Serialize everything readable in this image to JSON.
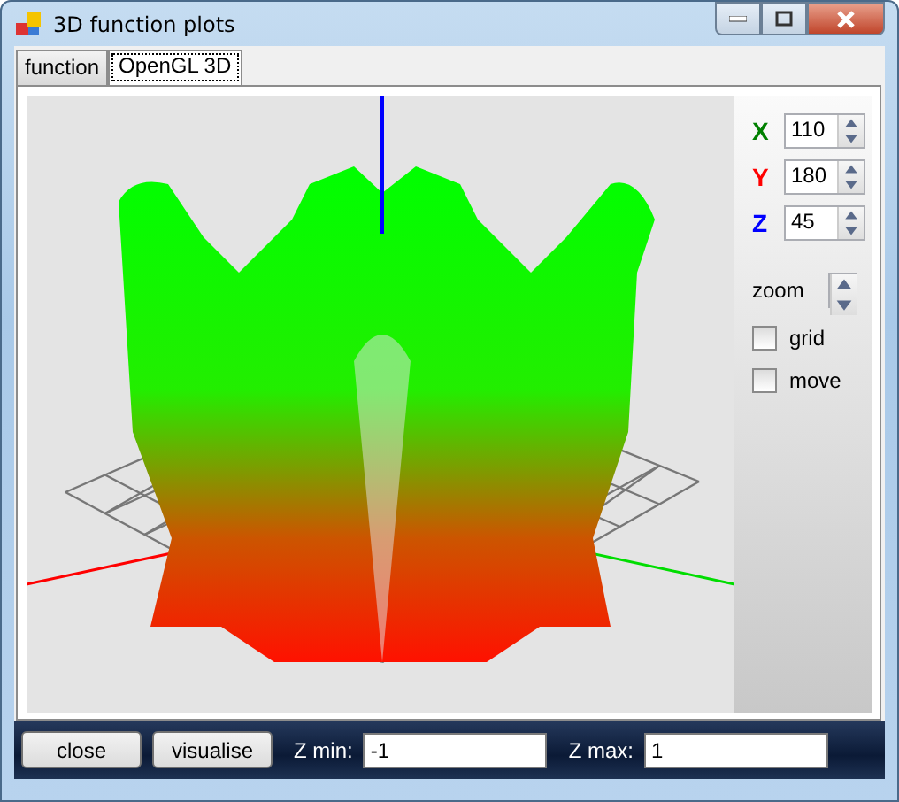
{
  "window": {
    "title": "3D function plots"
  },
  "tabs": [
    {
      "label": "function",
      "selected": false
    },
    {
      "label": "OpenGL 3D",
      "selected": true
    }
  ],
  "rotation": [
    {
      "axis": "X",
      "value": "110",
      "color": "#008000"
    },
    {
      "axis": "Y",
      "value": "180",
      "color": "#ff0000"
    },
    {
      "axis": "Z",
      "value": "45",
      "color": "#0000ff"
    }
  ],
  "zoom": {
    "label": "zoom"
  },
  "options": [
    {
      "label": "grid",
      "checked": false
    },
    {
      "label": "move",
      "checked": false
    }
  ],
  "buttons": [
    "close",
    "visualise"
  ],
  "range": [
    {
      "label": "Z min:",
      "value": "-1"
    },
    {
      "label": "Z max:",
      "value": "1"
    }
  ]
}
